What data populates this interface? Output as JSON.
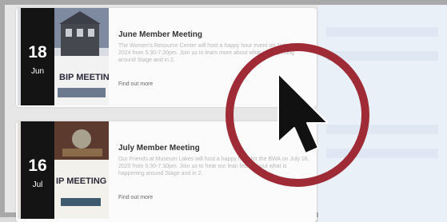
{
  "events": [
    {
      "day": "18",
      "month": "Jun",
      "title": "June Member Meeting",
      "description": "The Women's Resource Center will host a happy hour event on June 18th, 2024 from 5:30-7:30pm. Join us to learn more about what is happening around Stage and in 2.",
      "link_label": "Find out more",
      "poster_text": "BIP MEETING"
    },
    {
      "day": "16",
      "month": "Jul",
      "title": "July Member Meeting",
      "description": "Our Friends at Museum Lakes will host a happy hour for the BWA on July 16, 2020 from 5:30-7:30pm. Join us to hear our lean learn about what is happening around Stage and in 2.",
      "link_label": "Find out more",
      "poster_text": "IP MEETING"
    }
  ],
  "overlay": {
    "ring_color": "#9e2b35",
    "icon": "cursor-arrow-icon"
  }
}
